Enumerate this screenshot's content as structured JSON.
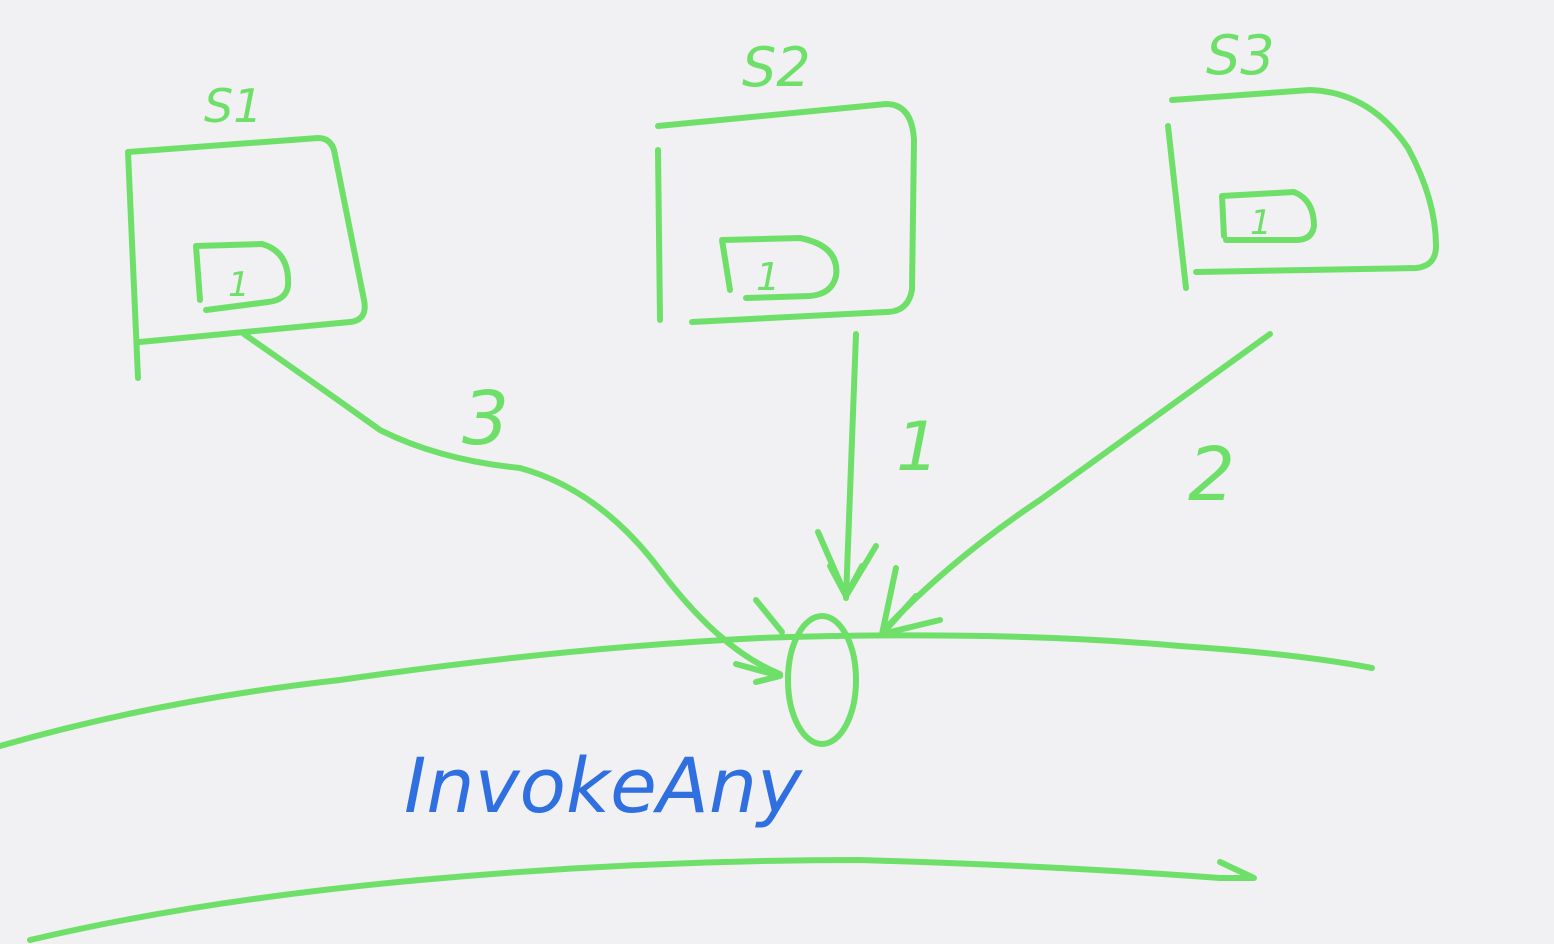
{
  "colors": {
    "background": "#f1f0f2",
    "green_ink": "#6ee06a",
    "blue_ink": "#2f6fe0"
  },
  "servers": [
    {
      "label": "S1",
      "inner": "1"
    },
    {
      "label": "S2",
      "inner": "1"
    },
    {
      "label": "S3",
      "inner": "1"
    }
  ],
  "edges": [
    {
      "from": "S1",
      "label": "3"
    },
    {
      "from": "S2",
      "label": "1"
    },
    {
      "from": "S3",
      "label": "2"
    }
  ],
  "band_label": "InvokeAny"
}
